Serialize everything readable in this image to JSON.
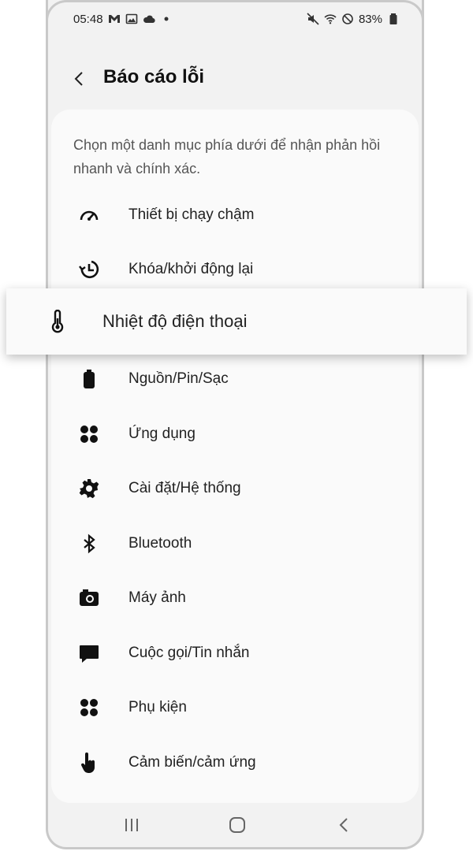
{
  "status_bar": {
    "time": "05:48",
    "battery": "83%"
  },
  "header": {
    "title": "Báo cáo lỗi"
  },
  "description": "Chọn một danh mục phía dưới để nhận phản hồi nhanh và chính xác.",
  "items": [
    {
      "label": "Thiết bị chạy chậm",
      "icon": "speedometer-icon"
    },
    {
      "label": "Khóa/khởi động lại",
      "icon": "restart-icon"
    },
    {
      "label": "Nhiệt độ điện thoại",
      "icon": "thermometer-icon"
    },
    {
      "label": "Nguồn/Pin/Sạc",
      "icon": "battery-icon"
    },
    {
      "label": "Ứng dụng",
      "icon": "apps-icon"
    },
    {
      "label": "Cài đặt/Hệ thống",
      "icon": "gear-icon"
    },
    {
      "label": "Bluetooth",
      "icon": "bluetooth-icon"
    },
    {
      "label": "Máy ảnh",
      "icon": "camera-icon"
    },
    {
      "label": "Cuộc gọi/Tin nhắn",
      "icon": "message-icon"
    },
    {
      "label": "Phụ kiện",
      "icon": "accessories-icon"
    },
    {
      "label": "Cảm biến/cảm ứng",
      "icon": "touch-icon"
    }
  ],
  "colors": {
    "background": "#f2f2f2",
    "card": "#fafafa",
    "text": "#222222"
  }
}
